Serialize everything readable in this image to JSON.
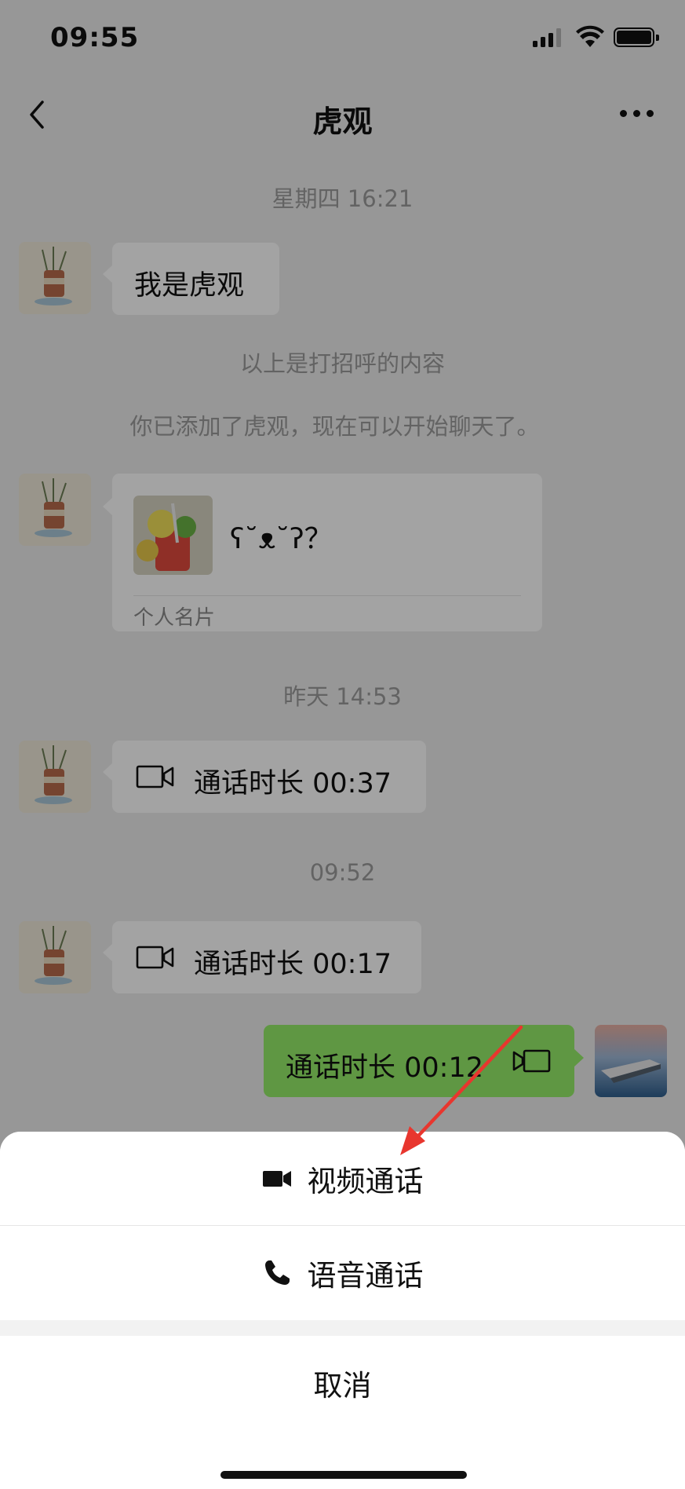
{
  "status_bar": {
    "time": "09:55"
  },
  "nav": {
    "title": "虎观"
  },
  "chat": {
    "timestamps": [
      "星期四 16:21",
      "昨天 14:53",
      "09:52"
    ],
    "greeting_message": "我是虎观",
    "system_messages": [
      "以上是打招呼的内容",
      "你已添加了虎观，现在可以开始聊天了。"
    ],
    "contact_card": {
      "name": "ʕ˘ᴥ˘ʔ？",
      "label": "个人名片"
    },
    "call_records": [
      {
        "sender": "friend",
        "text": "通话时长 00:37",
        "icon": "video-camera-icon"
      },
      {
        "sender": "friend",
        "text": "通话时长 00:17",
        "icon": "video-camera-icon"
      },
      {
        "sender": "self",
        "text": "通话时长 00:12",
        "icon": "video-camera-icon"
      }
    ]
  },
  "action_sheet": {
    "video_call": {
      "label": "视频通话",
      "icon": "video-camera-icon"
    },
    "voice_call": {
      "label": "语音通话",
      "icon": "phone-icon"
    },
    "cancel": {
      "label": "取消"
    }
  },
  "colors": {
    "self_bubble": "#95ec69",
    "friend_bubble": "#ffffff",
    "annotation_arrow": "#e8362e",
    "chat_background": "#ededed"
  }
}
